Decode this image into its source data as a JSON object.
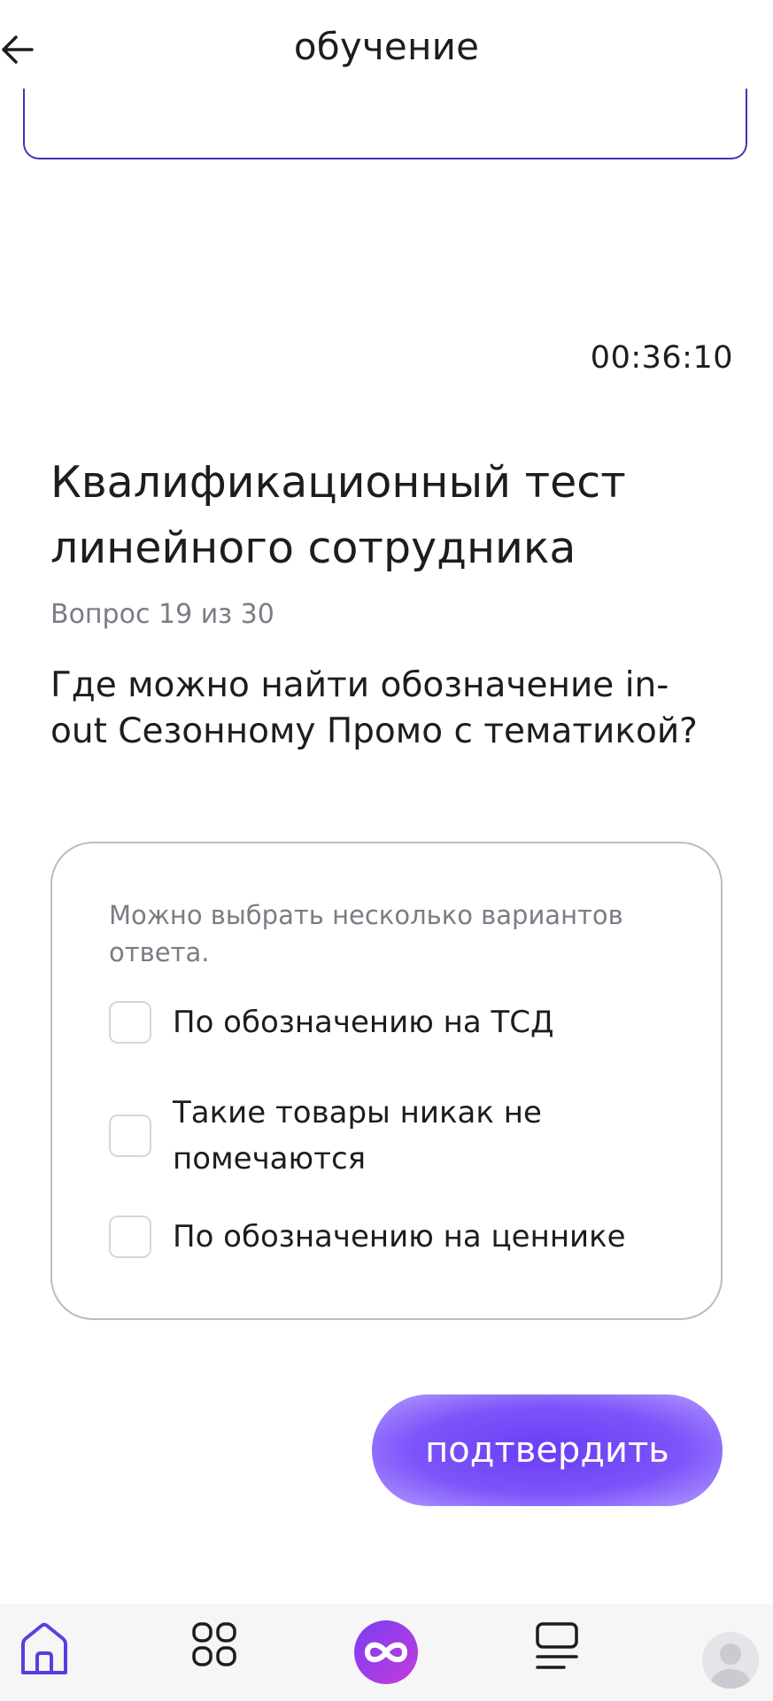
{
  "header": {
    "title": "обучение",
    "back_icon": "arrow-left-icon"
  },
  "timer": "00:36:10",
  "test": {
    "title": "Квалификационный тест линейного сотрудника",
    "counter": "Вопрос 19 из 30",
    "question": "Где можно найти обозначение in-out Сезонному Промо с тематикой?"
  },
  "answers": {
    "hint": "Можно выбрать несколько вариантов ответа.",
    "options": [
      {
        "label": "По обозначению на ТСД",
        "checked": false
      },
      {
        "label": "Такие товары никак не помечаются",
        "checked": false
      },
      {
        "label": "По обозначению на ценнике",
        "checked": false
      }
    ]
  },
  "confirm_label": "подтвердить",
  "nav": {
    "items": [
      "home-icon",
      "apps-grid-icon",
      "infinity-icon",
      "courses-icon",
      "profile-avatar-icon"
    ],
    "accent": "#5b3ee0"
  }
}
